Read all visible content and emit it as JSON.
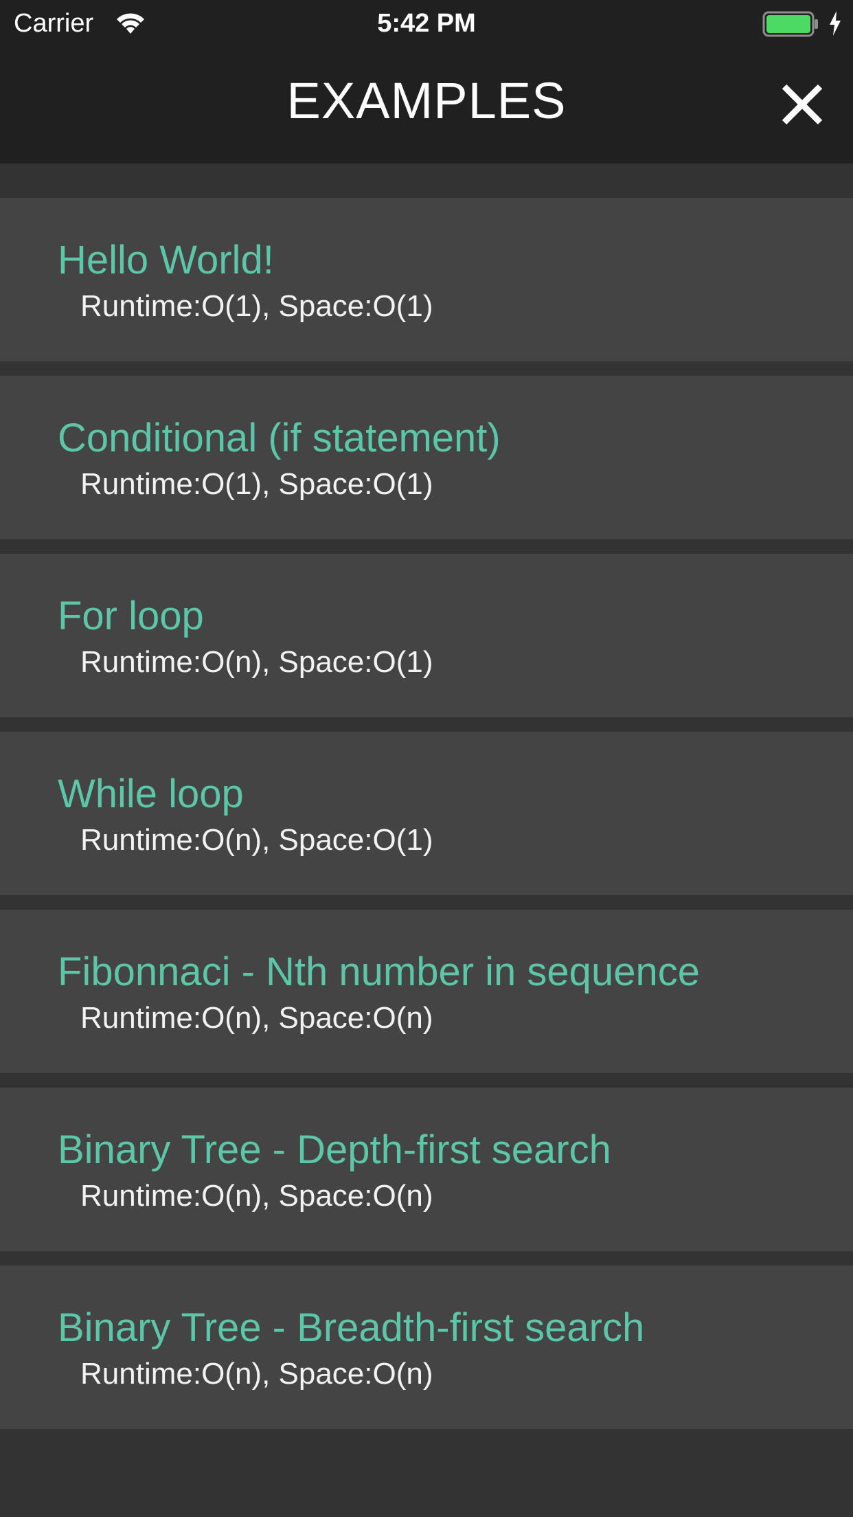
{
  "status_bar": {
    "carrier": "Carrier",
    "time": "5:42 PM",
    "icons": [
      "wifi-icon",
      "battery-icon",
      "charging-icon"
    ]
  },
  "nav": {
    "title": "EXAMPLES",
    "close_icon": "close-icon"
  },
  "colors": {
    "background": "#333333",
    "bar": "#202020",
    "row": "#444444",
    "accent": "#5cc7a8",
    "text": "#f2f2f2",
    "battery": "#4cd964"
  },
  "examples": [
    {
      "title": "Hello World!",
      "complexity": "Runtime:O(1), Space:O(1)"
    },
    {
      "title": "Conditional (if statement)",
      "complexity": "Runtime:O(1), Space:O(1)"
    },
    {
      "title": "For loop",
      "complexity": "Runtime:O(n), Space:O(1)"
    },
    {
      "title": "While loop",
      "complexity": "Runtime:O(n), Space:O(1)"
    },
    {
      "title": "Fibonnaci - Nth number in sequence",
      "complexity": "Runtime:O(n), Space:O(n)"
    },
    {
      "title": "Binary Tree - Depth-first search",
      "complexity": "Runtime:O(n), Space:O(n)"
    },
    {
      "title": "Binary Tree - Breadth-first search",
      "complexity": "Runtime:O(n), Space:O(n)"
    }
  ]
}
